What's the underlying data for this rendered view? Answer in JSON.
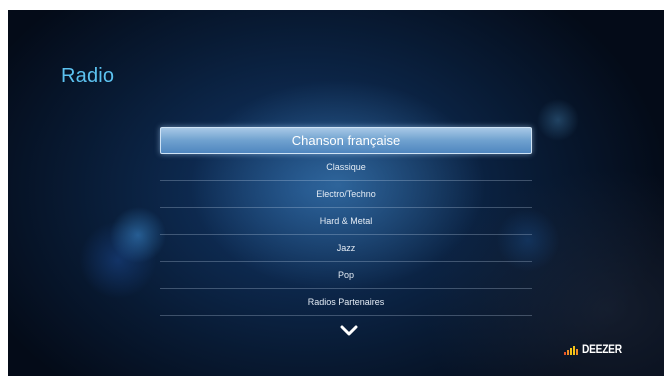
{
  "header": {
    "title": "Radio"
  },
  "menu": {
    "items": [
      {
        "label": "Chanson française",
        "selected": true
      },
      {
        "label": "Classique",
        "selected": false
      },
      {
        "label": "Electro/Techno",
        "selected": false
      },
      {
        "label": "Hard & Metal",
        "selected": false
      },
      {
        "label": "Jazz",
        "selected": false
      },
      {
        "label": "Pop",
        "selected": false
      },
      {
        "label": "Radios Partenaires",
        "selected": false
      }
    ],
    "more_indicator_icon": "chevron-down-icon"
  },
  "brand": {
    "logo_text": "DEEZER",
    "bar_colors": [
      "#e8542b",
      "#f08c22",
      "#f5c518",
      "#f5c518",
      "#f08c22"
    ]
  },
  "colors": {
    "title": "#5cc2f0",
    "selection": "#6fa1cf",
    "background": "#0a2244"
  }
}
